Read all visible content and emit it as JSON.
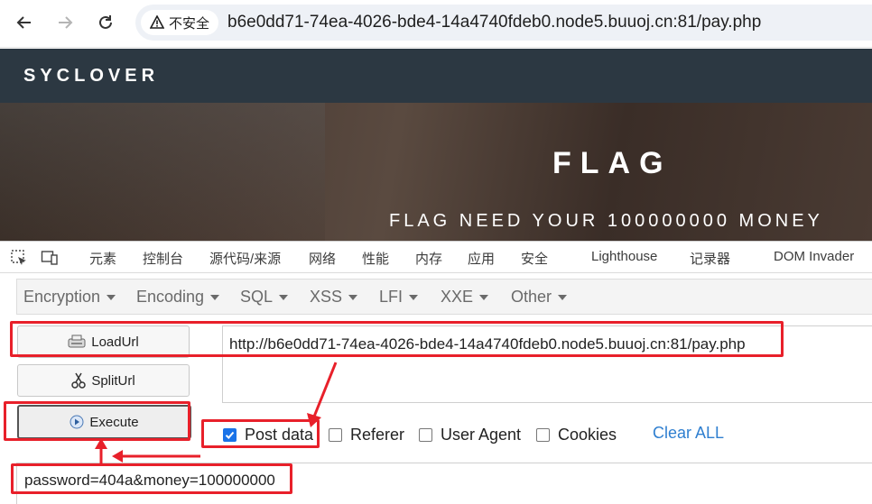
{
  "browser": {
    "security_label": "不安全",
    "url": "b6e0dd71-74ea-4026-bde4-14a4740fdeb0.node5.buuoj.cn:81/pay.php"
  },
  "site": {
    "brand": "SYCLOVER",
    "hero_title": "FLAG",
    "hero_subtitle": "FLAG NEED YOUR 100000000 MONEY"
  },
  "devtools": {
    "tabs": [
      "元素",
      "控制台",
      "源代码/来源",
      "网络",
      "性能",
      "内存",
      "应用",
      "安全",
      "Lighthouse",
      "记录器",
      "DOM Invader"
    ]
  },
  "hackbar": {
    "menus": [
      "Encryption",
      "Encoding",
      "SQL",
      "XSS",
      "LFI",
      "XXE",
      "Other"
    ],
    "load_url_label": "LoadUrl",
    "split_url_label": "SplitUrl",
    "execute_label": "Execute",
    "url_value": "http://b6e0dd71-74ea-4026-bde4-14a4740fdeb0.node5.buuoj.cn:81/pay.php",
    "options": [
      {
        "label": "Post data",
        "checked": true
      },
      {
        "label": "Referer",
        "checked": false
      },
      {
        "label": "User Agent",
        "checked": false
      },
      {
        "label": "Cookies",
        "checked": false
      }
    ],
    "clear_all_label": "Clear ALL",
    "post_data_value": "password=404a&money=100000000"
  },
  "annotation_color": "#e8202a"
}
